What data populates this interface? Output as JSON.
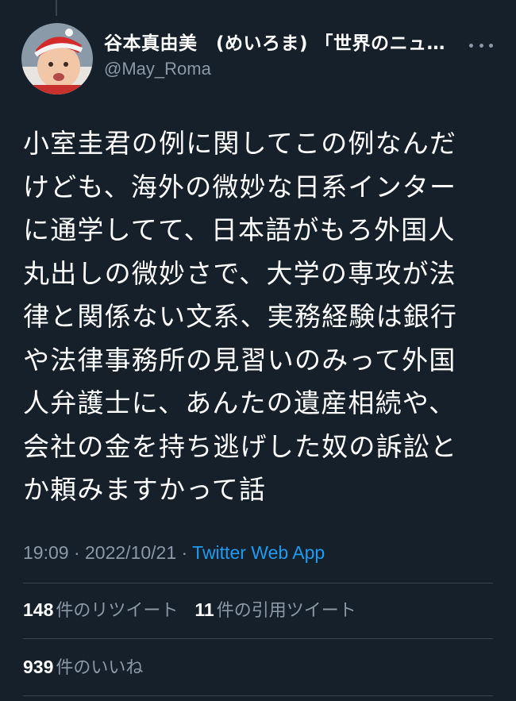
{
  "tweet": {
    "author": {
      "display_name": "谷本真由美　(めいろま) 「世界のニュ…",
      "handle": "@May_Roma",
      "avatar": "baby-in-santa-hat-avatar"
    },
    "more_icon": "more-horizontal-icon",
    "text": "小室圭君の例に関してこの例なんだ\nけども、海外の微妙な日系インター\nに通学してて、日本語がもろ外国人\n丸出しの微妙さで、大学の専攻が法\n律と関係ない文系、実務経験は銀行\nや法律事務所の見習いのみって外国\n人弁護士に、あんたの遺産相続や、\n会社の金を持ち逃げした奴の訴訟と\nか頼みますかって話",
    "time": "19:09",
    "separator": " · ",
    "date": "2022/10/21",
    "source": "Twitter Web App"
  },
  "stats": {
    "retweets": {
      "count": "148",
      "label": "件のリツイート"
    },
    "quotes": {
      "count": "11",
      "label": "件の引用ツイート"
    },
    "likes": {
      "count": "939",
      "label": "件のいいね"
    }
  },
  "colors": {
    "background": "#15202b",
    "text_primary": "#ffffff",
    "text_secondary": "#8b98a5",
    "link": "#1d9bf0",
    "divider": "#38444d"
  }
}
